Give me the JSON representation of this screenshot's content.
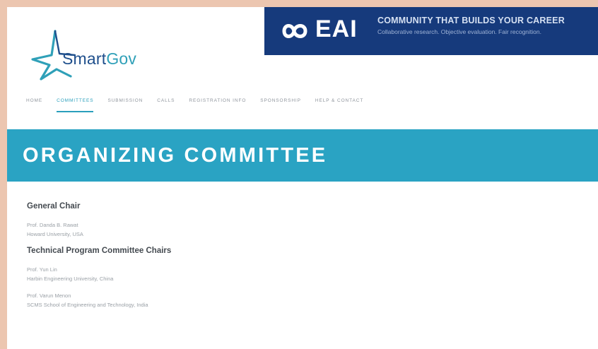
{
  "logo": {
    "text_main": "Smart",
    "text_accent": "Gov"
  },
  "banner": {
    "brand": "EAI",
    "tagline": "COMMUNITY THAT BUILDS YOUR CAREER",
    "subline": "Collaborative research. Objective evaluation. Fair recognition."
  },
  "nav": {
    "items": [
      {
        "label": "HOME"
      },
      {
        "label": "COMMITTEES",
        "active": true
      },
      {
        "label": "SUBMISSION"
      },
      {
        "label": "CALLS"
      },
      {
        "label": "REGISTRATION INFO"
      },
      {
        "label": "SPONSORSHIP"
      },
      {
        "label": "HELP & CONTACT"
      }
    ]
  },
  "page": {
    "title": "ORGANIZING COMMITTEE"
  },
  "sections": [
    {
      "heading": "General Chair",
      "people": [
        {
          "name": "Prof. Danda B. Rawat",
          "affiliation": "Howard University, USA"
        }
      ]
    },
    {
      "heading": "Technical Program Committee Chairs",
      "people": [
        {
          "name": "Prof. Yun Lin",
          "affiliation": "Harbin Engineering University, China"
        },
        {
          "name": "Prof. Varun Menon",
          "affiliation": "SCMS School of Engineering and Technology, India"
        }
      ]
    }
  ],
  "colors": {
    "accent": "#2aa3c3",
    "banner_bg": "#163a7c",
    "frame": "#ecc6b0"
  }
}
